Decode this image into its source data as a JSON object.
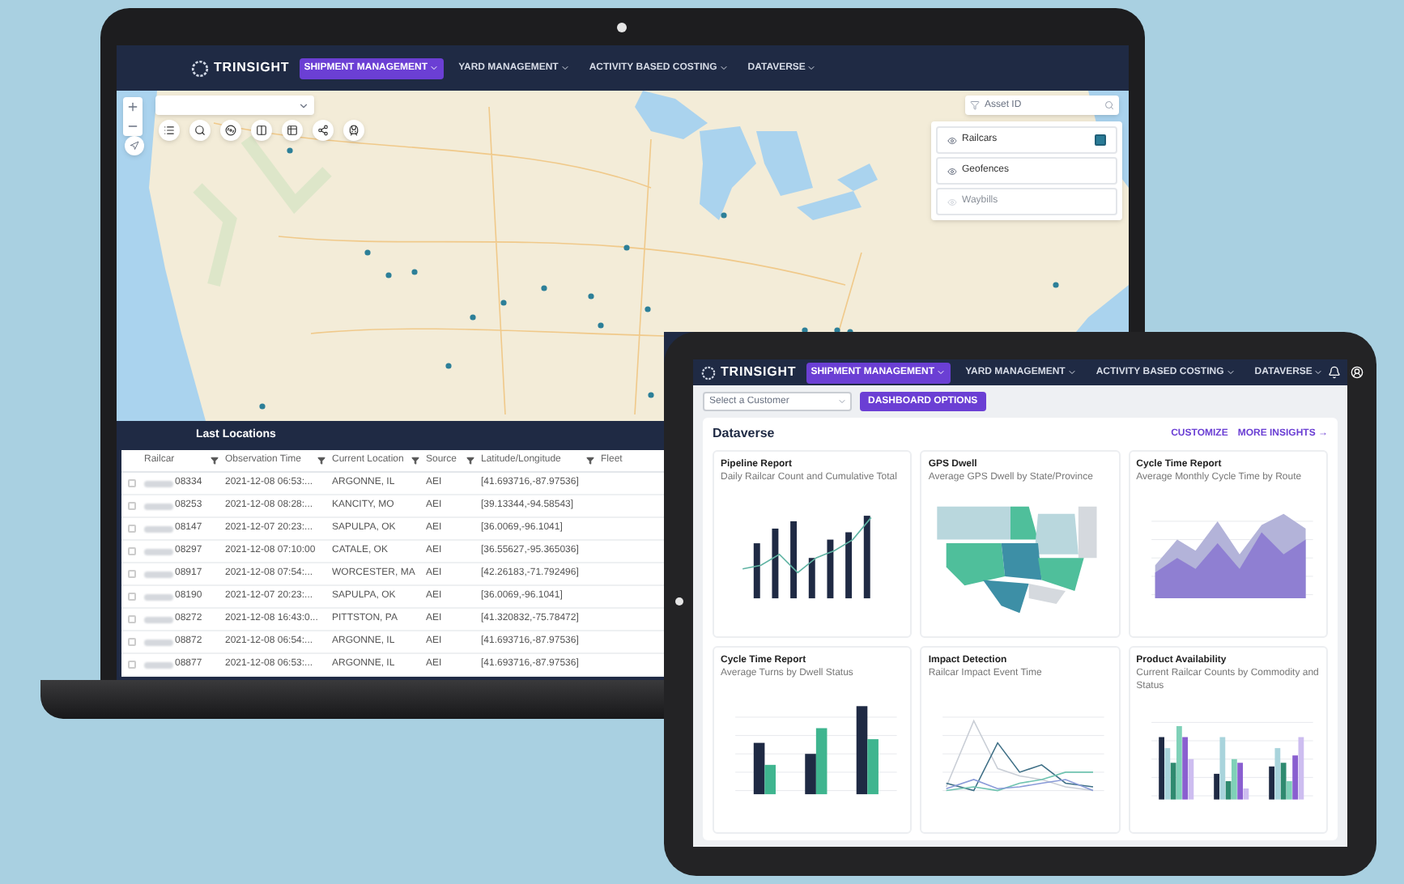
{
  "laptop": {
    "nav": {
      "logo": "TRINSIGHT",
      "items": [
        {
          "label": "SHIPMENT MANAGEMENT",
          "selected": true
        },
        {
          "label": "YARD MANAGEMENT",
          "selected": false
        },
        {
          "label": "ACTIVITY BASED COSTING",
          "selected": false
        },
        {
          "label": "DATAVERSE",
          "selected": false
        }
      ]
    },
    "map": {
      "search_placeholder": "Asset ID",
      "layers": [
        {
          "label": "Railcars",
          "checked": true,
          "disabled": false
        },
        {
          "label": "Geofences",
          "checked": false,
          "disabled": false
        },
        {
          "label": "Waybills",
          "checked": false,
          "disabled": true
        }
      ]
    },
    "table": {
      "title": "Last Locations",
      "columns": [
        "Railcar",
        "Observation Time",
        "Current Location",
        "Source",
        "Latitude/Longitude",
        "Fleet"
      ],
      "rows": [
        {
          "selected": false,
          "cells": [
            "08334",
            "2021-12-08 06:53:...",
            "ARGONNE, IL",
            "AEI",
            "[41.693716,-87.97536]"
          ]
        },
        {
          "selected": false,
          "cells": [
            "08253",
            "2021-12-08 08:28:...",
            "KANCITY, MO",
            "AEI",
            "[39.13344,-94.58543]"
          ]
        },
        {
          "selected": false,
          "cells": [
            "08147",
            "2021-12-07 20:23:...",
            "SAPULPA, OK",
            "AEI",
            "[36.0069,-96.1041]"
          ]
        },
        {
          "selected": false,
          "cells": [
            "08297",
            "2021-12-08 07:10:00",
            "CATALE, OK",
            "AEI",
            "[36.55627,-95.365036]"
          ]
        },
        {
          "selected": false,
          "cells": [
            "08917",
            "2021-12-08 07:54:...",
            "WORCESTER, MA",
            "AEI",
            "[42.26183,-71.792496]"
          ]
        },
        {
          "selected": false,
          "cells": [
            "08190",
            "2021-12-07 20:23:...",
            "SAPULPA, OK",
            "AEI",
            "[36.0069,-96.1041]"
          ]
        },
        {
          "selected": false,
          "cells": [
            "08272",
            "2021-12-08 16:43:0...",
            "PITTSTON, PA",
            "AEI",
            "[41.320832,-75.78472]"
          ]
        },
        {
          "selected": false,
          "cells": [
            "08872",
            "2021-12-08 06:54:...",
            "ARGONNE, IL",
            "AEI",
            "[41.693716,-87.97536]"
          ]
        },
        {
          "selected": false,
          "cells": [
            "08877",
            "2021-12-08 06:53:...",
            "ARGONNE, IL",
            "AEI",
            "[41.693716,-87.97536]"
          ]
        }
      ]
    }
  },
  "tablet": {
    "nav": {
      "logo": "TRINSIGHT",
      "items": [
        {
          "label": "SHIPMENT MANAGEMENT",
          "selected": true
        },
        {
          "label": "YARD MANAGEMENT",
          "selected": false
        },
        {
          "label": "ACTIVITY BASED COSTING",
          "selected": false
        },
        {
          "label": "DATAVERSE",
          "selected": false
        }
      ]
    },
    "customer_select": {
      "placeholder": "Select a Customer"
    },
    "dashboard_button": "DASHBOARD OPTIONS",
    "section": {
      "title": "Dataverse",
      "actions": [
        "CUSTOMIZE",
        "MORE INSIGHTS →"
      ],
      "cards": [
        {
          "kind": "bar_line",
          "title": "Pipeline Report",
          "subtitle": "Daily Railcar Count and Cumulative Total"
        },
        {
          "kind": "map",
          "title": "GPS Dwell",
          "subtitle": "Average GPS Dwell by State/Province"
        },
        {
          "kind": "area",
          "title": "Cycle Time Report",
          "subtitle": "Average Monthly Cycle Time by Route"
        },
        {
          "kind": "grouped_bar",
          "title": "Cycle Time Report",
          "subtitle": "Average Turns by Dwell Status"
        },
        {
          "kind": "line",
          "title": "Impact Detection",
          "subtitle": "Railcar Impact Event Time"
        },
        {
          "kind": "multi_bar",
          "title": "Product Availability",
          "subtitle": "Current Railcar Counts by Commodity and Status"
        }
      ]
    }
  }
}
